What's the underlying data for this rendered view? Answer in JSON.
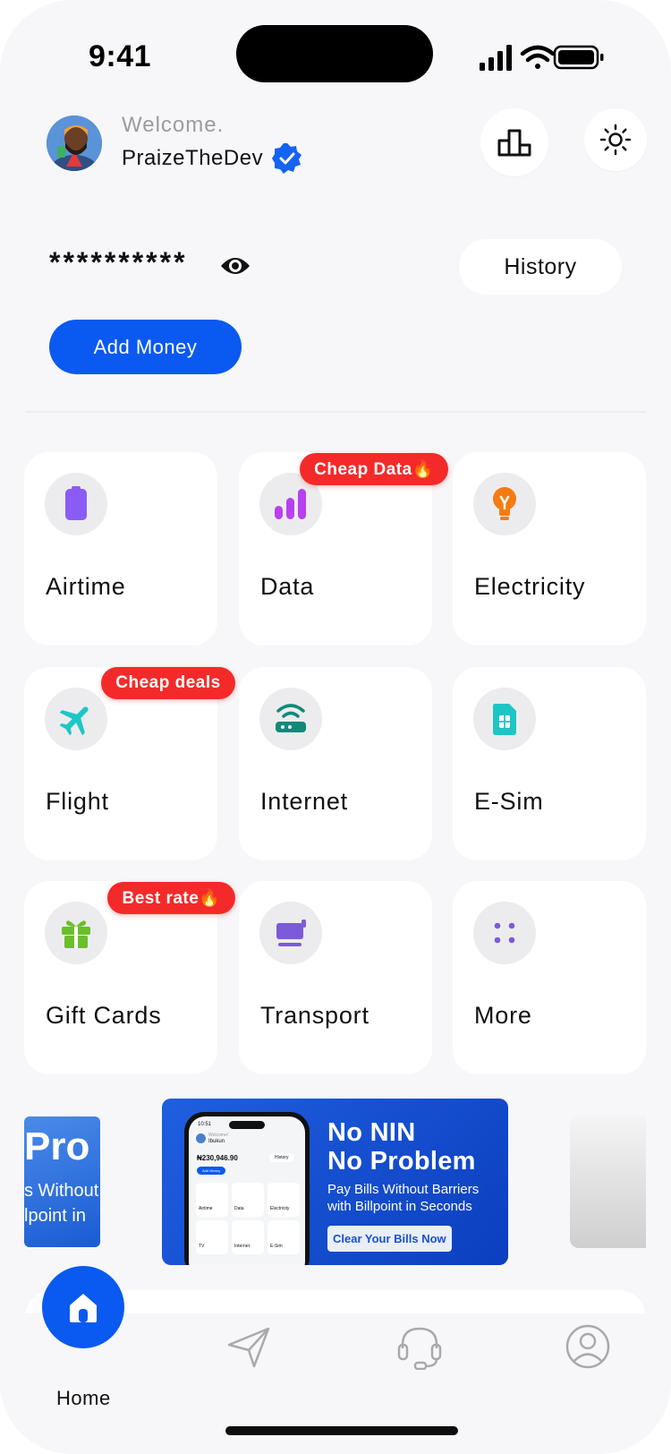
{
  "status_bar": {
    "time": "9:41"
  },
  "header": {
    "welcome": "Welcome.",
    "username": "PraizeTheDev"
  },
  "balance": {
    "masked": "**********",
    "history_label": "History",
    "add_money_label": "Add Money"
  },
  "services": [
    {
      "label": "Airtime",
      "icon": "phone-icon",
      "color": "#8a5cf6"
    },
    {
      "label": "Data",
      "icon": "signal-bars-icon",
      "color": "#b840f0",
      "badge": "Cheap Data🔥"
    },
    {
      "label": "Electricity",
      "icon": "bulb-icon",
      "color": "#f57c12"
    },
    {
      "label": "Flight",
      "icon": "airplane-icon",
      "color": "#1dc6c6",
      "badge": "Cheap deals"
    },
    {
      "label": "Internet",
      "icon": "router-icon",
      "color": "#0f8a78"
    },
    {
      "label": "E-Sim",
      "icon": "sim-icon",
      "color": "#1dc6c6"
    },
    {
      "label": "Gift Cards",
      "icon": "gift-icon",
      "color": "#6bbf2a",
      "badge": "Best rate🔥"
    },
    {
      "label": "Transport",
      "icon": "cart-icon",
      "color": "#7b5bd9"
    },
    {
      "label": "More",
      "icon": "dots-grid-icon",
      "color": "#7b5bd9"
    }
  ],
  "banners": {
    "left_partial": {
      "line1": "Pro",
      "line2": "s Without",
      "line3": "lpoint in"
    },
    "main": {
      "title_line1": "No NIN",
      "title_line2": "No Problem",
      "sub_line1": "Pay Bills Without Barriers",
      "sub_line2": "with Billpoint in Seconds",
      "cta": "Clear Your Bills Now",
      "mock": {
        "time": "10:51",
        "welcome": "Welcome!",
        "name": "Ibukun",
        "amount": "₦230,946.90",
        "history": "History",
        "add_money": "Add Money",
        "items": [
          "Airtime",
          "Data",
          "Electricity",
          "TV",
          "Internet",
          "E-Sim"
        ]
      }
    }
  },
  "nav": {
    "home_label": "Home"
  },
  "colors": {
    "primary": "#0a59f0",
    "badge": "#f42a2a",
    "background": "#f7f7f9"
  }
}
